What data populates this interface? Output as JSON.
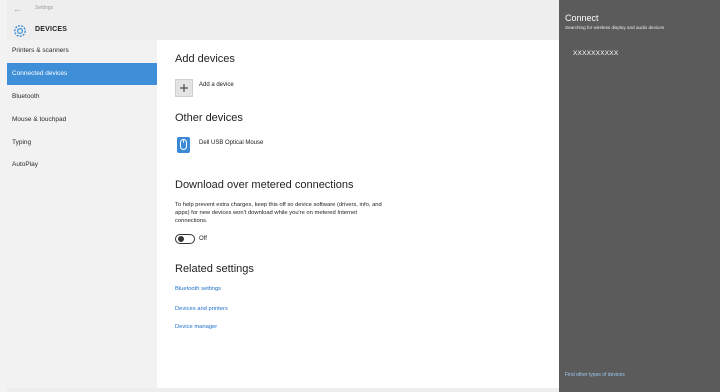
{
  "window": {
    "app_name": "Settings",
    "section_title": "DEVICES"
  },
  "sidebar": {
    "items": [
      {
        "label": "Printers & scanners",
        "selected": false
      },
      {
        "label": "Connected devices",
        "selected": true
      },
      {
        "label": "Bluetooth",
        "selected": false
      },
      {
        "label": "Mouse & touchpad",
        "selected": false
      },
      {
        "label": "Typing",
        "selected": false
      },
      {
        "label": "AutoPlay",
        "selected": false
      }
    ]
  },
  "main": {
    "add_devices_heading": "Add devices",
    "add_device_label": "Add a device",
    "other_devices_heading": "Other devices",
    "device_name": "Dell USB Optical Mouse",
    "metered_heading": "Download over metered connections",
    "metered_description": "To help prevent extra charges, keep this off so device software (drivers, info, and apps) for new devices won't download while you're on metered Internet connections.",
    "toggle_state": "Off",
    "related_heading": "Related settings",
    "related_links": [
      "Bluetooth settings",
      "Devices and printers",
      "Device manager"
    ]
  },
  "connect_panel": {
    "title": "Connect",
    "subtitle": "Searching for wireless display and audio devices",
    "device": "XXXXXXXXXX",
    "find_link": "Find other types of devices"
  },
  "colors": {
    "accent": "#3f8fd8",
    "panel": "#5b5b5b",
    "link": "#1e6fc9"
  }
}
